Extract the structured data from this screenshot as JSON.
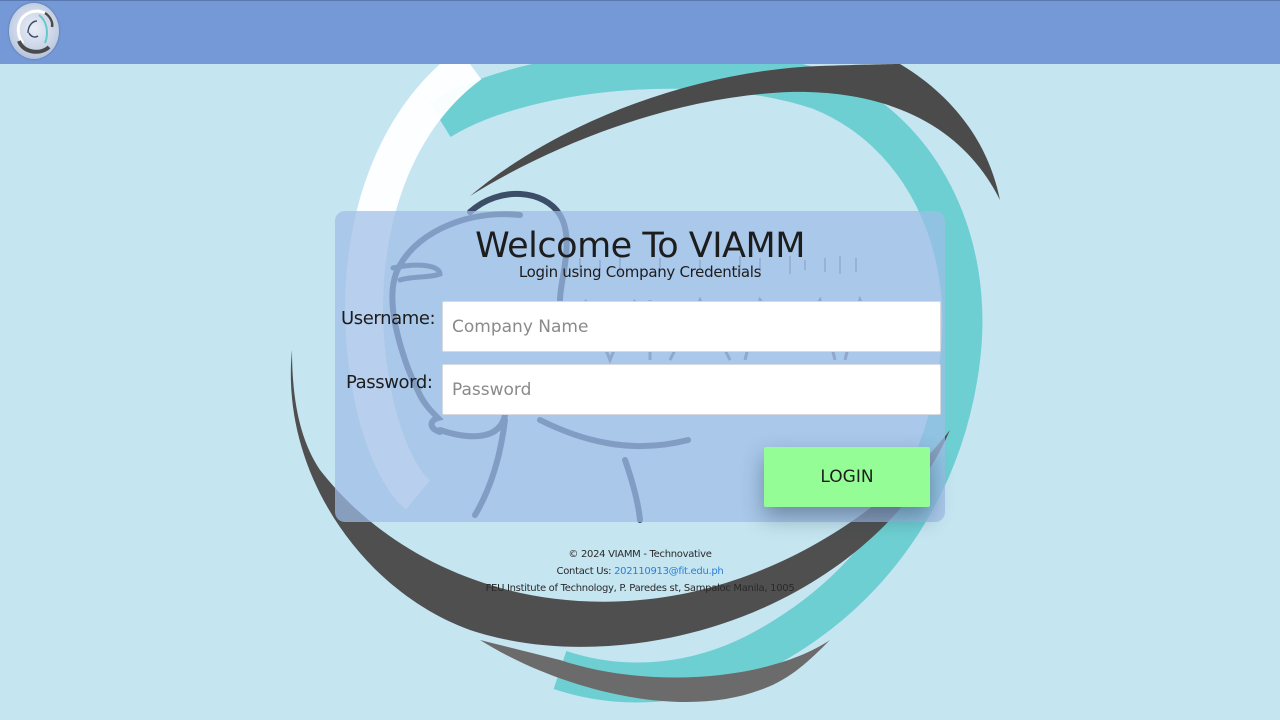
{
  "header": {
    "logo_icon": "viamm-logo-icon",
    "color": "#7599d6"
  },
  "background": {
    "color": "#c5e5f1",
    "watermark": "viamm-logo-watermark"
  },
  "login": {
    "title": "Welcome To VIAMM",
    "subtitle": "Login using Company Credentials",
    "username_label": "Username:",
    "username_placeholder": "Company Name",
    "username_value": "",
    "password_label": "Password:",
    "password_placeholder": "Password",
    "password_value": "",
    "button_label": "LOGIN",
    "button_color": "#95fd95"
  },
  "footer": {
    "copyright": "© 2024 VIAMM - Technovative",
    "contact_prefix": "Contact Us: ",
    "contact_email": "202110913@fit.edu.ph",
    "address": "FEU Institute of Technology, P. Paredes st, Sampaloc Manila, 1005"
  }
}
